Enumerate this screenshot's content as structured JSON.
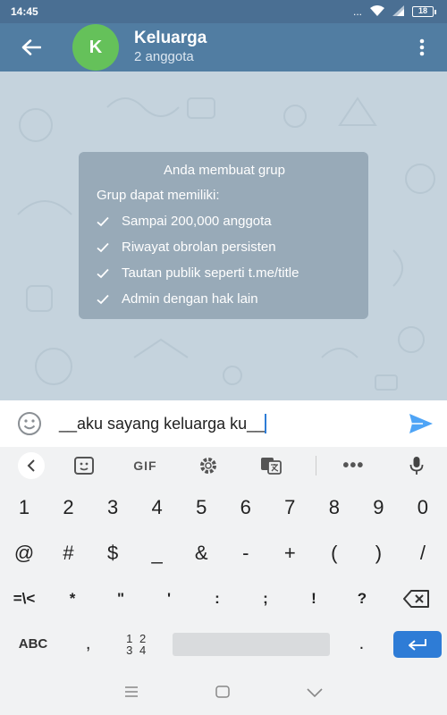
{
  "status_bar": {
    "time": "14:45",
    "dots": "...",
    "battery_level": "18"
  },
  "header": {
    "avatar_letter": "K",
    "title": "Keluarga",
    "subtitle": "2 anggota"
  },
  "info_card": {
    "title": "Anda membuat grup",
    "subtitle": "Grup dapat memiliki:",
    "items": [
      "Sampai 200,000 anggota",
      "Riwayat obrolan persisten",
      "Tautan publik seperti t.me/title",
      "Admin dengan hak lain"
    ]
  },
  "composer": {
    "message": "__aku sayang keluarga ku__"
  },
  "keyboard_toolbar": {
    "gif_label": "GIF",
    "more_label": "•••"
  },
  "keyboard": {
    "row1": [
      "1",
      "2",
      "3",
      "4",
      "5",
      "6",
      "7",
      "8",
      "9",
      "0"
    ],
    "row2": [
      "@",
      "#",
      "$",
      "_",
      "&",
      "-",
      "+",
      "(",
      ")",
      "/"
    ],
    "row3": [
      "=\\<",
      "*",
      "\"",
      "'",
      ":",
      ";",
      "!",
      "?"
    ],
    "abc_label": "ABC",
    "comma_label": ",",
    "num_label_top": "1 2",
    "num_label_bottom": "3 4",
    "dot_label": "."
  },
  "colors": {
    "header": "#517da2",
    "status_bar": "#4a6f93",
    "avatar": "#65c15a",
    "accent": "#2e7cd6",
    "chat_background": "#c5d3dd"
  }
}
